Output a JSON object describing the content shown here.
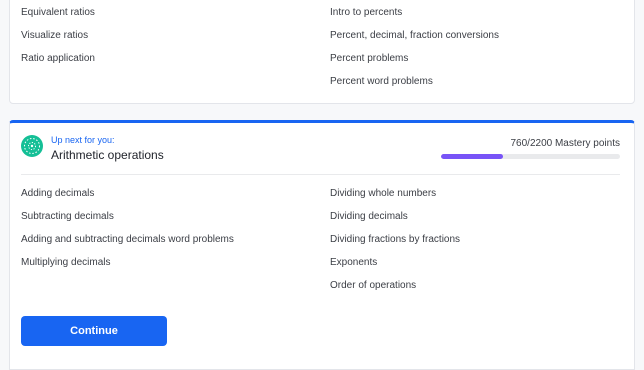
{
  "previous_unit": {
    "left_skills": [
      "Equivalent ratios",
      "Visualize ratios",
      "Ratio application"
    ],
    "right_skills": [
      "Intro to percents",
      "Percent, decimal, fraction conversions",
      "Percent problems",
      "Percent word problems"
    ]
  },
  "next_unit": {
    "up_next_label": "Up next for you:",
    "title": "Arithmetic operations",
    "icon": "globe-icon",
    "mastery_text": "760/2200 Mastery points",
    "mastery_progress": 0.345,
    "left_skills": [
      "Adding decimals",
      "Subtracting decimals",
      "Adding and subtracting decimals word problems",
      "Multiplying decimals"
    ],
    "right_skills": [
      "Dividing whole numbers",
      "Dividing decimals",
      "Dividing fractions by fractions",
      "Exponents",
      "Order of operations"
    ],
    "continue_label": "Continue"
  },
  "colors": {
    "accent": "#1865f2",
    "progress": "#7854f7",
    "globe": "#14bf96"
  }
}
